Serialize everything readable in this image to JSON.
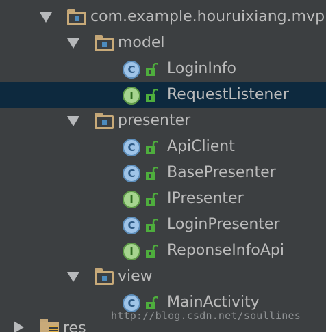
{
  "tree": {
    "package": {
      "label": "com.example.houruixiang.mvp"
    },
    "model": {
      "label": "model",
      "items": [
        {
          "label": "LoginInfo",
          "kind": "class",
          "badge": "C"
        },
        {
          "label": "RequestListener",
          "kind": "interface",
          "badge": "I"
        }
      ]
    },
    "presenter": {
      "label": "presenter",
      "items": [
        {
          "label": "ApiClient",
          "kind": "class",
          "badge": "C"
        },
        {
          "label": "BasePresenter",
          "kind": "class",
          "badge": "C"
        },
        {
          "label": "IPresenter",
          "kind": "interface",
          "badge": "I"
        },
        {
          "label": "LoginPresenter",
          "kind": "class",
          "badge": "C"
        },
        {
          "label": "ReponseInfoApi",
          "kind": "interface",
          "badge": "I"
        }
      ]
    },
    "view": {
      "label": "view",
      "items": [
        {
          "label": "MainActivity",
          "kind": "class",
          "badge": "C"
        }
      ]
    },
    "res": {
      "label": "res"
    }
  },
  "watermark": "http://blog.csdn.net/soullines",
  "colors": {
    "background": "#3c3f41",
    "selected_row": "#0d293e",
    "text": "#bbbbbb",
    "folder": "#c8aa79",
    "class_badge": "#9fc4e8",
    "interface_badge": "#a6d48f",
    "lock_green": "#4eae3d"
  }
}
